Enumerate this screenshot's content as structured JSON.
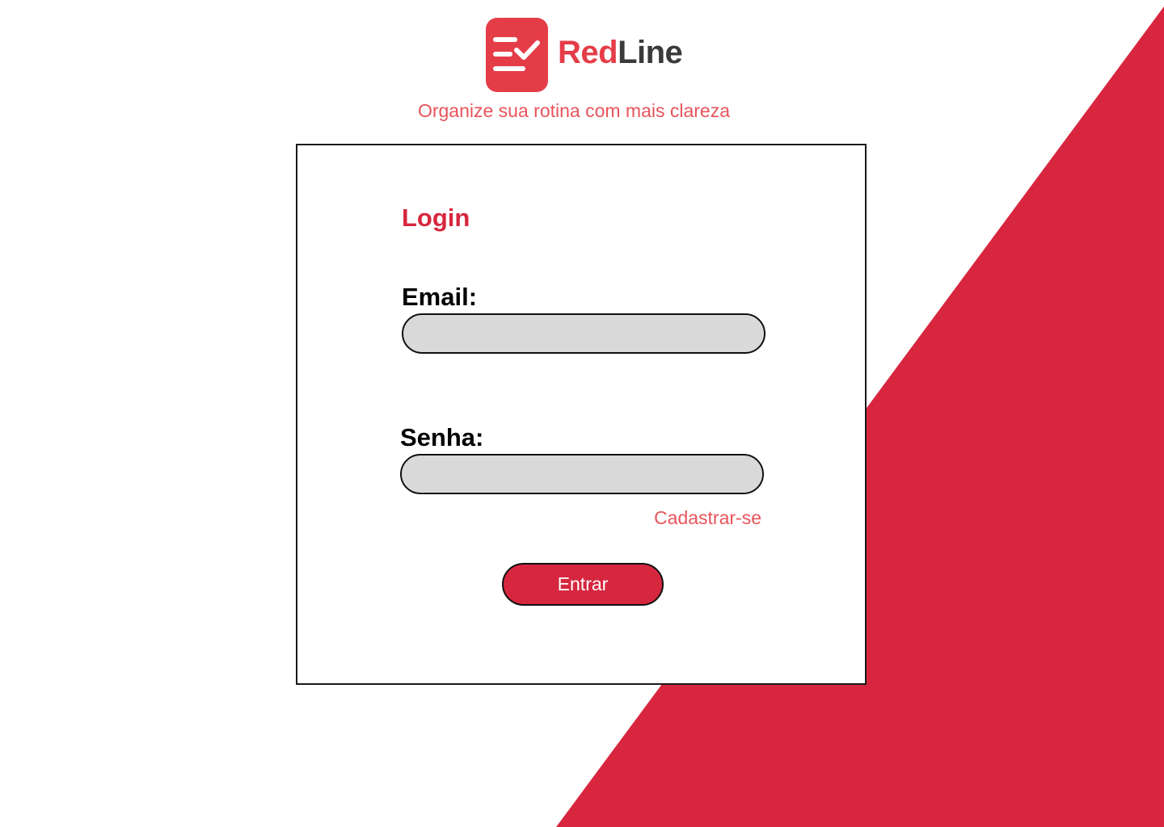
{
  "brand": {
    "name_part1": "Red",
    "name_part2": "Line",
    "logo_icon": "checklist-icon",
    "tagline": "Organize sua rotina com mais clareza"
  },
  "login": {
    "title": "Login",
    "email_label": "Email:",
    "email_value": "",
    "senha_label": "Senha:",
    "senha_value": "",
    "signup_link": "Cadastrar-se",
    "submit_label": "Entrar"
  },
  "colors": {
    "primary_red": "#d6273f",
    "logo_red": "#e53d48",
    "accent_text_red": "#e8545b",
    "input_fill": "#d9d9d9",
    "background_shape_red": "#d8263f"
  }
}
